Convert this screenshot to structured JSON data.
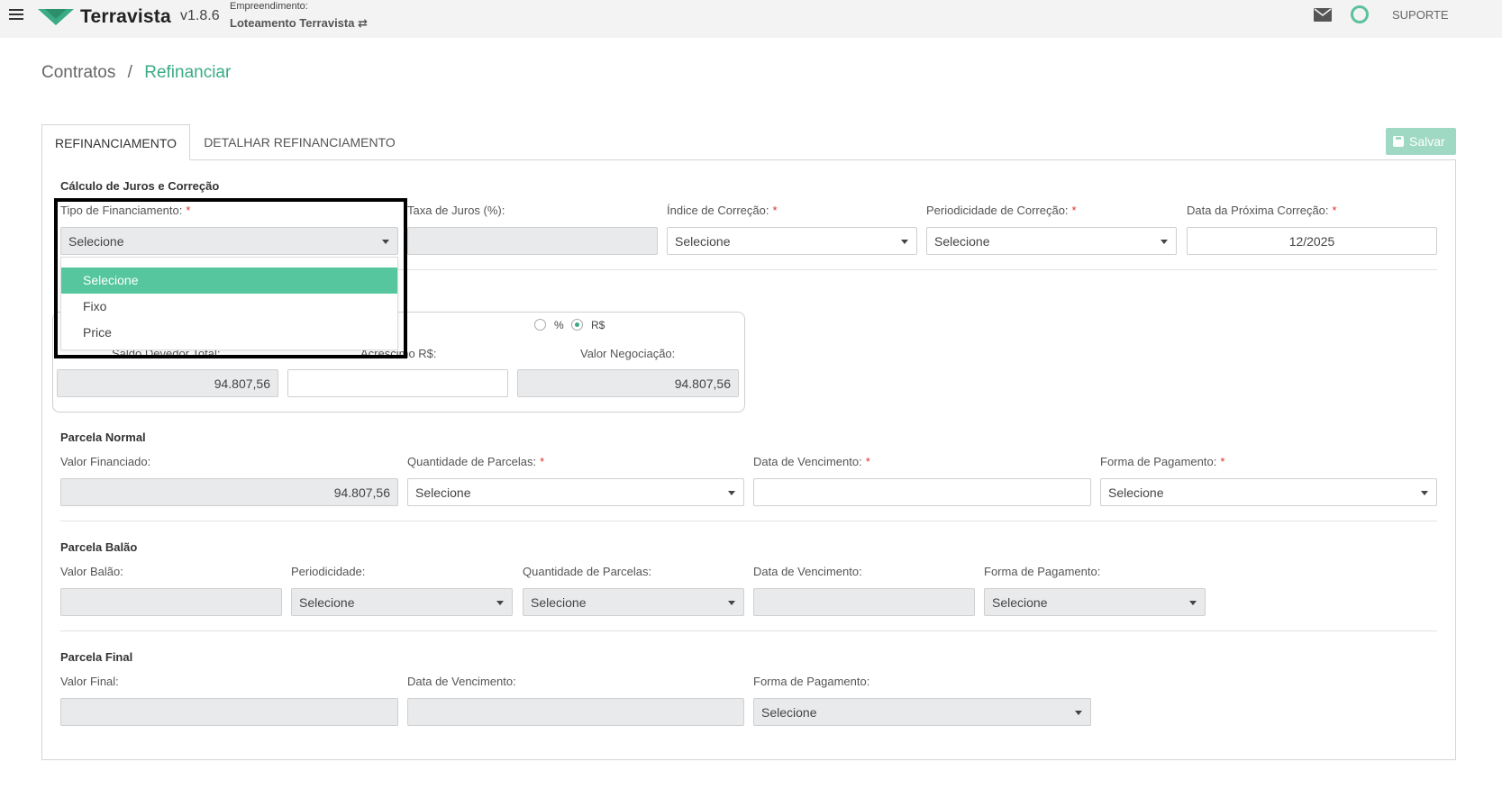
{
  "header": {
    "brand": "Terravista",
    "version": "v1.8.6",
    "empreendimento_label": "Empreendimento:",
    "empreendimento_value": "Loteamento Terravista ⇄",
    "support": "SUPORTE",
    "brand_color": "#3aab84"
  },
  "breadcrumb": {
    "parent": "Contratos",
    "separator": "/",
    "current": "Refinanciar"
  },
  "tabs": [
    {
      "label": "REFINANCIAMENTO",
      "active": true
    },
    {
      "label": "DETALHAR REFINANCIAMENTO",
      "active": false
    }
  ],
  "toolbar": {
    "save_label": "Salvar"
  },
  "calculo": {
    "title": "Cálculo de Juros e Correção",
    "tipo_label": "Tipo de Financiamento:",
    "tipo_value": "Selecione",
    "tipo_options": [
      "Selecione",
      "Fixo",
      "Price"
    ],
    "taxa_label": "Taxa de Juros (%):",
    "taxa_value": "",
    "indice_label": "Índice de Correção:",
    "indice_value": "Selecione",
    "periodicidade_label": "Periodicidade de Correção:",
    "periodicidade_value": "Selecione",
    "data_label": "Data da Próxima Correção:",
    "data_value": "12/2025"
  },
  "negociacao": {
    "radio_percent": "%",
    "radio_real": "R$",
    "selected": "R$",
    "saldo_label": "Saldo Devedor Total:",
    "saldo_value": "94.807,56",
    "acrescimo_label": "Acrescimo R$:",
    "acrescimo_value": "",
    "valor_label": "Valor Negociação:",
    "valor_value": "94.807,56"
  },
  "parcela_normal": {
    "title": "Parcela Normal",
    "valor_label": "Valor Financiado:",
    "valor_value": "94.807,56",
    "quantidade_label": "Quantidade de Parcelas:",
    "quantidade_value": "Selecione",
    "vencimento_label": "Data de Vencimento:",
    "vencimento_value": "",
    "forma_label": "Forma de Pagamento:",
    "forma_value": "Selecione"
  },
  "parcela_balao": {
    "title": "Parcela Balão",
    "valor_label": "Valor Balão:",
    "periodicidade_label": "Periodicidade:",
    "periodicidade_value": "Selecione",
    "quantidade_label": "Quantidade de Parcelas:",
    "quantidade_value": "Selecione",
    "vencimento_label": "Data de Vencimento:",
    "forma_label": "Forma de Pagamento:",
    "forma_value": "Selecione"
  },
  "parcela_final": {
    "title": "Parcela Final",
    "valor_label": "Valor Final:",
    "vencimento_label": "Data de Vencimento:",
    "forma_label": "Forma de Pagamento:",
    "forma_value": "Selecione"
  }
}
